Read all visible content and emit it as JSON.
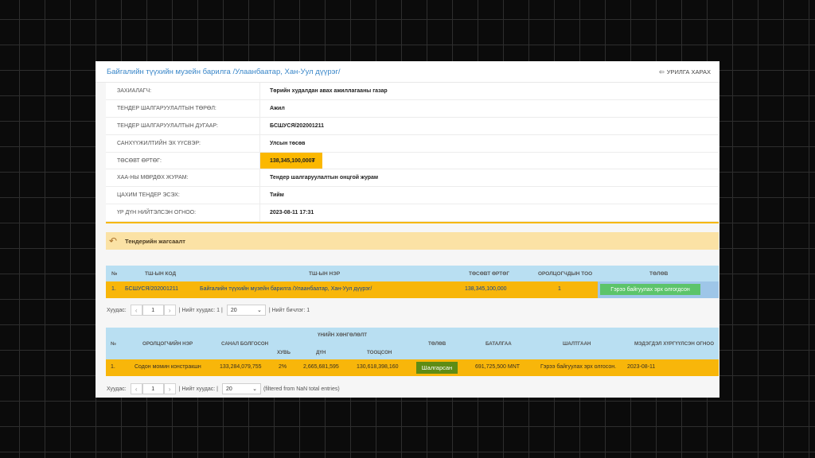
{
  "header": {
    "title": "Байгалийн түүхийн музейн барилга /Улаанбаатар, Хан-Уул дүүрэг/",
    "back_label": "УРИЛГА ХАРАХ"
  },
  "info": [
    {
      "label": "ЗАХИАЛАГЧ:",
      "value": "Төрийн худалдан авах ажиллагааны газар"
    },
    {
      "label": "ТЕНДЕР ШАЛГАРУУЛАЛТЫН ТӨРӨЛ:",
      "value": "Ажил"
    },
    {
      "label": "ТЕНДЕР ШАЛГАРУУЛАЛТЫН ДУГААР:",
      "value": "БСШУСЯ/202001211"
    },
    {
      "label": "САНХҮҮЖИЛТИЙН ЭХ ҮҮСВЭР:",
      "value": "Улсын төсөв"
    },
    {
      "label": "ТӨСӨВТ ӨРТӨГ:",
      "value": "138,345,100,000₮"
    },
    {
      "label": "ХАА-НЫ МӨРДӨХ ЖУРАМ:",
      "value": "Тендер шалгаруулалтын онцгой журам"
    },
    {
      "label": "ЦАХИМ ТЕНДЕР ЭСЭХ:",
      "value": "Тийм"
    },
    {
      "label": "ҮР ДҮН НИЙТЭЛСЭН ОГНОО:",
      "value": "2023-08-11 17:31"
    }
  ],
  "section": {
    "title": "Тендерийн жагсаалт"
  },
  "table1": {
    "headers": [
      "№",
      "ТШ-ЫН КОД",
      "ТШ-ЫН НЭР",
      "ТӨСӨВТ ӨРТӨГ",
      "ОРОЛЦОГЧДЫН ТОО",
      "ТӨЛӨВ"
    ],
    "row": {
      "num": "1.",
      "code": "БСШУСЯ/202001211",
      "name": "Байгалийн түүхийн музейн барилга /Улаанбаатар, Хан-Уул дүүрэг/",
      "budget": "138,345,100,000",
      "count": "1",
      "status": "Гэрээ байгуулах эрх олгогдсон"
    }
  },
  "pager1": {
    "label": "Хуудас:",
    "prev": "‹",
    "page": "1",
    "next": "›",
    "total": "| Нийт хуудас: 1 |",
    "per_page": "20",
    "entries": "| Нийт бичлэг: 1"
  },
  "table2": {
    "headers": {
      "num": "№",
      "bidder": "ОРОЛЦОГЧИЙН НЭР",
      "offer": "САНАЛ БОЛГОСОН",
      "discount": "ҮНИЙН ХӨНГӨЛӨЛТ",
      "percent": "ХУВЬ",
      "amount": "ДҮН",
      "calculated": "ТООЦСОН",
      "status": "ТӨЛӨВ",
      "guarantee": "БАТАЛГАА",
      "reason": "ШАЛТГААН",
      "date": "МЭДЭГДЭЛ ХҮРГҮҮЛСЭН ОГНОО"
    },
    "row": {
      "num": "1.",
      "bidder": "Содон момин констракшн",
      "offer": "133,284,079,755",
      "percent": "2%",
      "amount": "2,665,681,595",
      "calculated": "130,618,398,160",
      "status": "Шалгарсан",
      "guarantee": "691,725,500 MNT",
      "reason": "Гэрээ байгуулах эрх олгосон.",
      "date": "2023-08-11"
    }
  },
  "pager2": {
    "label": "Хуудас:",
    "prev": "‹",
    "page": "1",
    "next": "›",
    "total": "| Нийт хуудас: |",
    "per_page": "20",
    "entries": "(filtered from NaN total entries)"
  }
}
